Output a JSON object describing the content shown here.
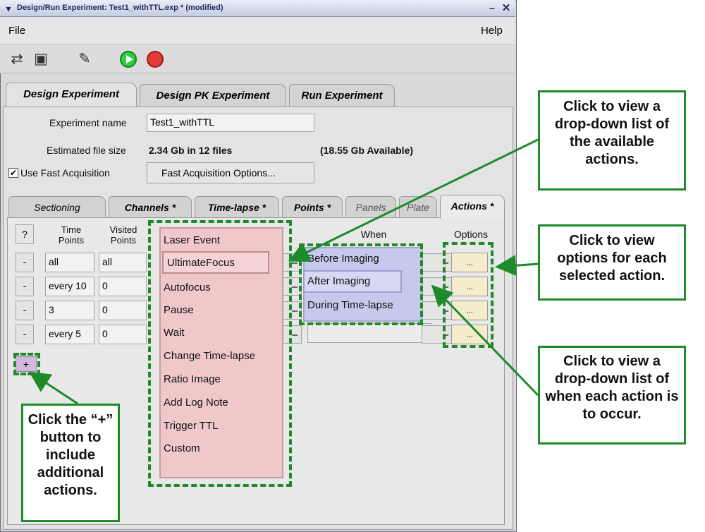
{
  "window": {
    "title": "Design/Run Experiment: Test1_withTTL.exp * (modified)",
    "minimize": "–",
    "close": "✕"
  },
  "menu": {
    "file": "File",
    "help": "Help"
  },
  "top_tabs": [
    "Design Experiment",
    "Design PK Experiment",
    "Run Experiment"
  ],
  "form": {
    "experiment_name_label": "Experiment name",
    "experiment_name_value": "Test1_withTTL",
    "file_size_label": "Estimated file size",
    "file_size_value": "2.34 Gb in 12 files",
    "available": "(18.55 Gb Available)",
    "fast_acq_checked": "✔",
    "fast_acq_label": "Use Fast Acquisition",
    "fast_acq_options": "Fast Acquisition Options..."
  },
  "sub_tabs": [
    "Sectioning",
    "Channels *",
    "Time-lapse *",
    "Points *",
    "Panels",
    "Plate",
    "Actions *"
  ],
  "grid": {
    "help": "?",
    "time_points_1": "Time",
    "time_points_2": "Points",
    "visited_points_1": "Visited",
    "visited_points_2": "Points",
    "when": "When",
    "options": "Options",
    "remove": "-",
    "option_btn": "...",
    "rows": [
      {
        "time": "all",
        "visited": "all"
      },
      {
        "time": "every 10",
        "visited": "0"
      },
      {
        "time": "3",
        "visited": "0"
      },
      {
        "time": "every 5",
        "visited": "0"
      }
    ],
    "add": "+"
  },
  "action_list": [
    "Laser Event",
    "UltimateFocus",
    "Autofocus",
    "Pause",
    "Wait",
    "Change Time-lapse",
    "Ratio Image",
    "Add Log Note",
    "Trigger TTL",
    "Custom"
  ],
  "when_list": [
    "Before Imaging",
    "After Imaging",
    "During Time-lapse"
  ],
  "callouts": {
    "actions": "Click to view a drop-down list of the available actions.",
    "options": "Click to view options for each selected action.",
    "when": "Click to view a drop-down list of when each action is to occur.",
    "add": "Click the “+” button to include additional actions."
  },
  "colors": {
    "annotation_green": "#1e8a2a",
    "action_list": "#f0c8ca",
    "when_list": "#c6c8ec",
    "option_btn": "#f4eccd"
  }
}
